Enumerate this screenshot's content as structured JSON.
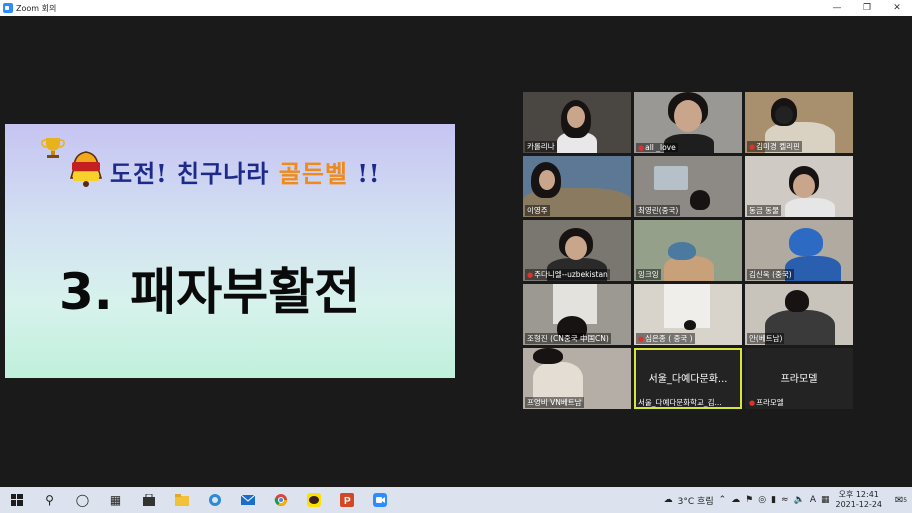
{
  "window": {
    "title": "Zoom 회의",
    "minimize_icon": "minimize-icon",
    "maximize_icon": "restore-icon",
    "close_icon": "close-icon"
  },
  "share_screen": {
    "heading_part1": "도전! 친구나라 ",
    "heading_part2": "골든벨",
    "heading_part3": " !!",
    "subtitle": "3. 패자부활전",
    "logo_text": "도전 골든벨",
    "colors": {
      "heading": "#1d2a8a",
      "accent": "#f08a1a"
    }
  },
  "participants": [
    {
      "name": "카롤리나",
      "muted": false
    },
    {
      "name": "all _love",
      "muted": true
    },
    {
      "name": "김미경 켈리핀",
      "muted": true
    },
    {
      "name": "이영주",
      "muted": false
    },
    {
      "name": "최영린(중국)",
      "muted": false
    },
    {
      "name": "동금 동물",
      "muted": false
    },
    {
      "name": "주다니엘--uzbekistan",
      "muted": true
    },
    {
      "name": "잉크잉",
      "muted": false
    },
    {
      "name": "김신욱 (중국)",
      "muted": false
    },
    {
      "name": "조형진 (CN중국 中国CN)",
      "muted": false
    },
    {
      "name": "심은종 ( 중국 )",
      "muted": true
    },
    {
      "name": "안(베트남)",
      "muted": false
    },
    {
      "name": "프엉비 VN베트남",
      "muted": false
    },
    {
      "name": "서울_다예다문화학교_김...",
      "center_label": "서울_다예다문화...",
      "muted": false,
      "active": true
    },
    {
      "name": "프라모엘",
      "center_label": "프라모델",
      "muted": true
    }
  ],
  "taskbar": {
    "weather": "3°C 흐림",
    "time": "오후 12:41",
    "date": "2021-12-24",
    "ime": "A",
    "notification_count": "5",
    "apps": [
      "start-icon",
      "search-icon",
      "task-view-icon",
      "widgets-icon",
      "store-icon",
      "file-explorer-icon",
      "edge-icon",
      "mail-icon",
      "chrome-icon",
      "kakaotalk-icon",
      "powerpoint-icon",
      "zoom-icon"
    ]
  }
}
